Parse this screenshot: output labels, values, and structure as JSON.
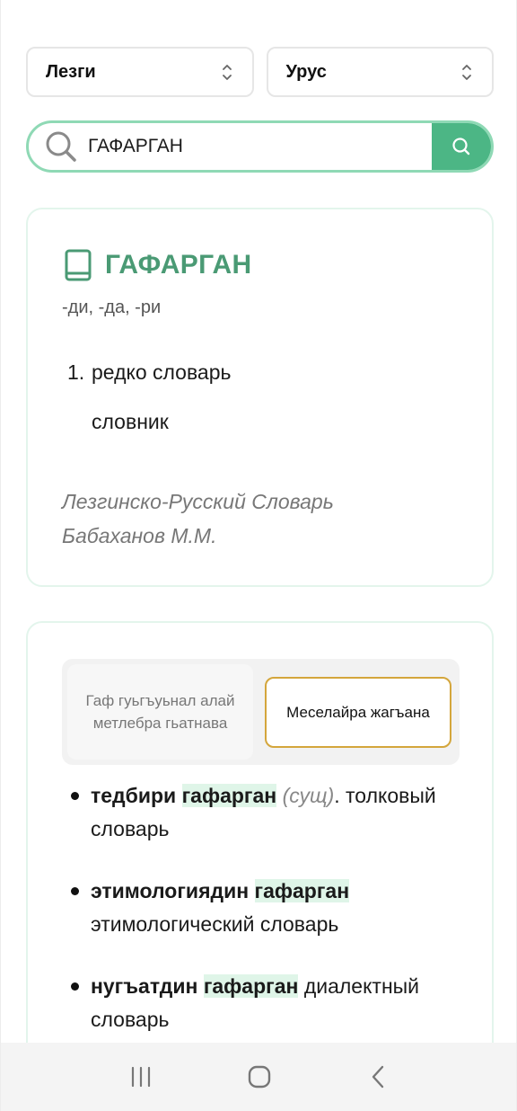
{
  "language_selector": {
    "source_language": "Лезги",
    "target_language": "Урус"
  },
  "search": {
    "query": "ГАФАРГАН"
  },
  "entry": {
    "headword": "ГАФАРГАН",
    "grammar": "-ди, -да, -ри",
    "definitions": [
      {
        "number": "1.",
        "text": "редко словарь"
      },
      {
        "number": "",
        "text": "словник"
      }
    ],
    "source_line_1": "Лезгинско-Русский Словарь",
    "source_line_2": "Бабаханов М.М."
  },
  "usage_tabs": {
    "tab_1": "Гаф гуьгъуьнал алай метлебра гьатнава",
    "tab_2": "Меселайра жагъана",
    "active_tab": "tab_2"
  },
  "examples": [
    {
      "term": "тедбири",
      "highlight": "гафарган",
      "pos": "(сущ)",
      "punct": ".",
      "translation": "толковый словарь"
    },
    {
      "term": "этимологиядин",
      "highlight": "гафарган",
      "pos": "",
      "punct": "",
      "translation": "этимологический словарь"
    },
    {
      "term": "нугъатдин",
      "highlight": "гафарган",
      "pos": "",
      "punct": "",
      "translation": "диалектный словарь"
    }
  ],
  "icons": {
    "select_arrows": "chevron-up-down-icon",
    "search": "magnifier-icon",
    "book": "book-icon",
    "nav_recents": "recents-icon",
    "nav_home": "home-icon",
    "nav_back": "back-icon"
  },
  "colors": {
    "accent_green": "#4cb685",
    "headword_green": "#4a9a74",
    "search_border": "#8fd9b5",
    "highlight_bg": "#dff5e8",
    "active_tab_border": "#d4a63c"
  }
}
